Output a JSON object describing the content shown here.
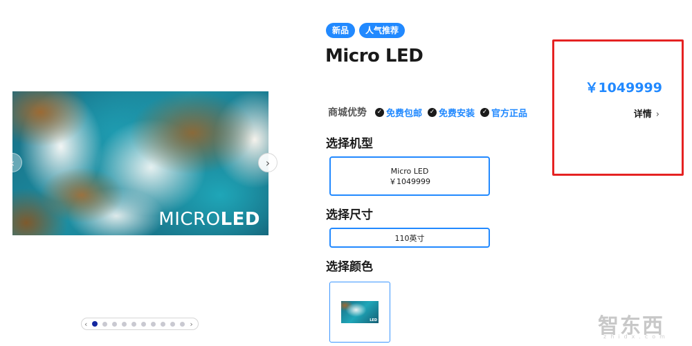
{
  "gallery": {
    "logo_light": "MICRO",
    "logo_bold": "LED",
    "prev_glyph": "‹",
    "next_glyph": "›",
    "dots_total": 10,
    "dots_active_index": 0
  },
  "badges": [
    "新品",
    "人气推荐"
  ],
  "product": {
    "title": "Micro LED"
  },
  "advantages": {
    "label": "商城优势",
    "items": [
      "免费包邮",
      "免费安装",
      "官方正品"
    ]
  },
  "model": {
    "heading": "选择机型",
    "option_name": "Micro LED",
    "option_price": "￥1049999"
  },
  "size": {
    "heading": "选择尺寸",
    "option": "110英寸"
  },
  "color": {
    "heading": "选择颜色",
    "swatch_text": "LED"
  },
  "price_box": {
    "price": "￥1049999",
    "details_label": "详情",
    "details_glyph": "›"
  },
  "watermark": {
    "text": "智东西",
    "sub": "zhidx.com"
  },
  "colors": {
    "accent": "#2189ff",
    "highlight_border": "#e52222",
    "dot_active": "#1428a0"
  }
}
